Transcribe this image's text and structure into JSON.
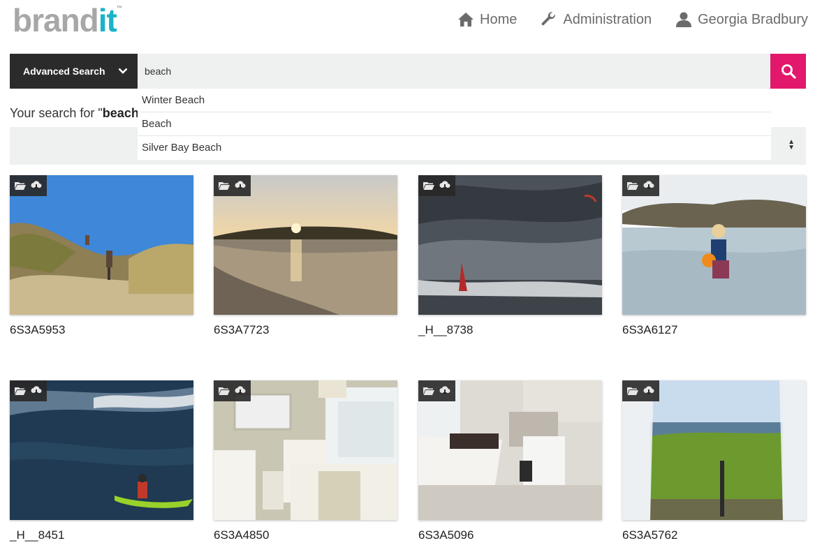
{
  "header": {
    "logo_brand": "brand",
    "logo_it": "it",
    "logo_tm": "™",
    "nav": [
      {
        "label": "Home",
        "icon": "home-icon"
      },
      {
        "label": "Administration",
        "icon": "wrench-icon"
      },
      {
        "label": "Georgia Bradbury",
        "icon": "user-icon"
      }
    ]
  },
  "search": {
    "advanced_label": "Advanced Search",
    "value": "beach",
    "suggestions": [
      "Winter Beach",
      "Beach",
      "Silver Bay Beach"
    ]
  },
  "results": {
    "prefix": "Your search for \"",
    "term": "beach"
  },
  "colors": {
    "accent": "#e2186c",
    "logo_it": "#1ab3c7",
    "dark": "#2b2b2b"
  },
  "assets": [
    {
      "name": "6S3A5953",
      "scene": "dunes"
    },
    {
      "name": "6S3A7723",
      "scene": "sunset"
    },
    {
      "name": "_H__8738",
      "scene": "windsurf"
    },
    {
      "name": "6S3A6127",
      "scene": "child"
    },
    {
      "name": "_H__8451",
      "scene": "kayak"
    },
    {
      "name": "6S3A4850",
      "scene": "bedroom"
    },
    {
      "name": "6S3A5096",
      "scene": "bathroom"
    },
    {
      "name": "6S3A5762",
      "scene": "window"
    }
  ]
}
